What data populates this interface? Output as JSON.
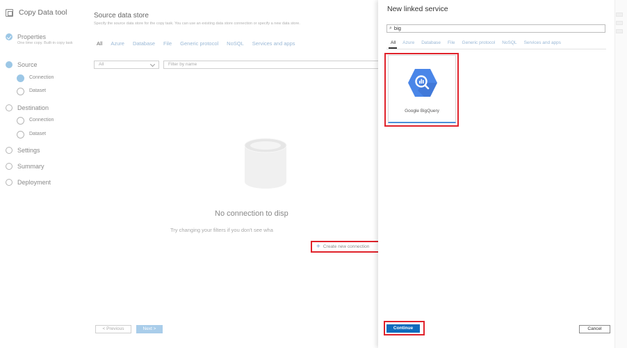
{
  "wizard": {
    "title": "Copy Data tool",
    "steps": [
      {
        "label": "Properties",
        "desc": "One time copy. Built-in copy task",
        "state": "done"
      },
      {
        "label": "Source",
        "state": "active"
      },
      {
        "label": "Destination",
        "state": "todo"
      },
      {
        "label": "Settings",
        "state": "todo"
      },
      {
        "label": "Summary",
        "state": "todo"
      },
      {
        "label": "Deployment",
        "state": "todo"
      }
    ],
    "source_substeps": [
      "Connection",
      "Dataset"
    ],
    "destination_substeps": [
      "Connection",
      "Dataset"
    ]
  },
  "main": {
    "title": "Source data store",
    "description": "Specify the source data store for the copy task. You can use an existing data store connection or specify a new data store.",
    "tabs": [
      "All",
      "Azure",
      "Database",
      "File",
      "Generic protocol",
      "NoSQL",
      "Services and apps"
    ],
    "active_tab": "All",
    "filter_select_value": "All",
    "filter_placeholder": "Filter by name",
    "empty_title": "No connection to disp",
    "empty_subtitle": "Try changing your filters if you don't see wha",
    "create_label": "Create new connection",
    "previous_label": "< Previous",
    "next_label": "Next >"
  },
  "panel": {
    "title": "New linked service",
    "search_value": "big",
    "tabs": [
      "All",
      "Azure",
      "Database",
      "File",
      "Generic protocol",
      "NoSQL",
      "Services and apps"
    ],
    "active_tab": "All",
    "tiles": [
      {
        "label": "Google BigQuery",
        "icon": "bigquery-icon"
      }
    ],
    "continue_label": "Continue",
    "cancel_label": "Cancel"
  },
  "colors": {
    "accent_blue": "#0f6cbd",
    "highlight_red": "#e0222b",
    "bigquery_blue": "#4a86e8"
  }
}
